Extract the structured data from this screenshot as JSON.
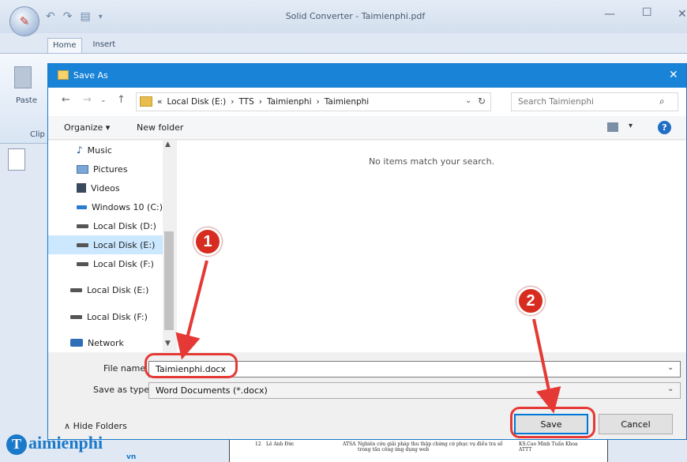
{
  "app": {
    "title": "Solid Converter - Taimienphi.pdf",
    "tabs": [
      "Home",
      "Insert"
    ],
    "paste_label": "Paste",
    "clipboard_label": "Clip"
  },
  "dialog": {
    "title": "Save As",
    "breadcrumb": [
      "«",
      "Local Disk (E:)",
      "›",
      "TTS",
      "›",
      "Taimienphi",
      "›",
      "Taimienphi"
    ],
    "search_placeholder": "Search Taimienphi",
    "organize_label": "Organize ▾",
    "new_folder_label": "New folder",
    "help_label": "?",
    "nav_items": [
      {
        "label": "Music",
        "icon": "music-icon"
      },
      {
        "label": "Pictures",
        "icon": "pictures-icon"
      },
      {
        "label": "Videos",
        "icon": "videos-icon"
      },
      {
        "label": "Windows 10 (C:)",
        "icon": "windows-drive-icon"
      },
      {
        "label": "Local Disk (D:)",
        "icon": "drive-icon"
      },
      {
        "label": "Local Disk (E:)",
        "icon": "drive-icon",
        "selected": true
      },
      {
        "label": "Local Disk (F:)",
        "icon": "drive-icon"
      },
      {
        "label": "Local Disk (E:)",
        "icon": "drive-icon"
      },
      {
        "label": "Local Disk (F:)",
        "icon": "drive-icon"
      },
      {
        "label": "Network",
        "icon": "network-icon"
      }
    ],
    "empty_message": "No items match your search.",
    "file_name_label": "File name",
    "file_name_value": "Taimienphi.docx",
    "save_as_type_label": "Save as type",
    "save_as_type_value": "Word Documents (*.docx)",
    "hide_folders_label": "Hide Folders",
    "save_label": "Save",
    "cancel_label": "Cancel"
  },
  "annotations": {
    "step1": "1",
    "step2": "2"
  },
  "watermark": {
    "logo": "T",
    "text": "aimienphi",
    "sub": "vn"
  },
  "doc_row": {
    "num": "12",
    "name": "Lê Anh Đức",
    "code": "ATSA",
    "topic": "Nghiên cứu giải pháp thu thập chứng cứ phục vụ điều tra số trong tấn công ứng dụng web",
    "advisor": "KS.Cao Minh Tuấn Khoa ATTT"
  },
  "colors": {
    "dialog_title_bg": "#1883d7",
    "highlight_ring": "#e53935",
    "badge": "#d62d20",
    "selected_item": "#cce8ff",
    "watermark": "#1b79c9"
  }
}
